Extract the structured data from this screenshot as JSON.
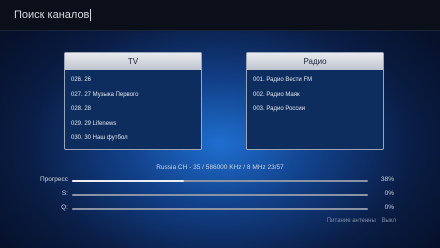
{
  "header": {
    "title": "Поиск каналов"
  },
  "tv_panel": {
    "title": "TV",
    "items": [
      "026. 26",
      "027. 27 Музыка Первого",
      "028. 28",
      "029. 29 Lifenews",
      "030. 30 Наш футбол"
    ]
  },
  "radio_panel": {
    "title": "Радио",
    "items": [
      "001. Радио Вести FM",
      "002. Радио Маяк",
      "003. Радио России"
    ]
  },
  "scan_info": {
    "text": "Russia  CH - 35  /  586000 KHz / 8 MHz  23/57"
  },
  "meters": [
    {
      "label": "Прогресс",
      "value_text": "38%",
      "fraction": 0.38
    },
    {
      "label": "S:",
      "value_text": "0%",
      "fraction": 0
    },
    {
      "label": "Q:",
      "value_text": "0%",
      "fraction": 0
    }
  ],
  "antenna": {
    "label": "Питание антенны",
    "value": "Выкл"
  },
  "colors": {
    "background": "#12418a",
    "header_bar": "#0b0f1a",
    "panel": "#0c2d5e",
    "meter_fill": "#e9edf2"
  }
}
